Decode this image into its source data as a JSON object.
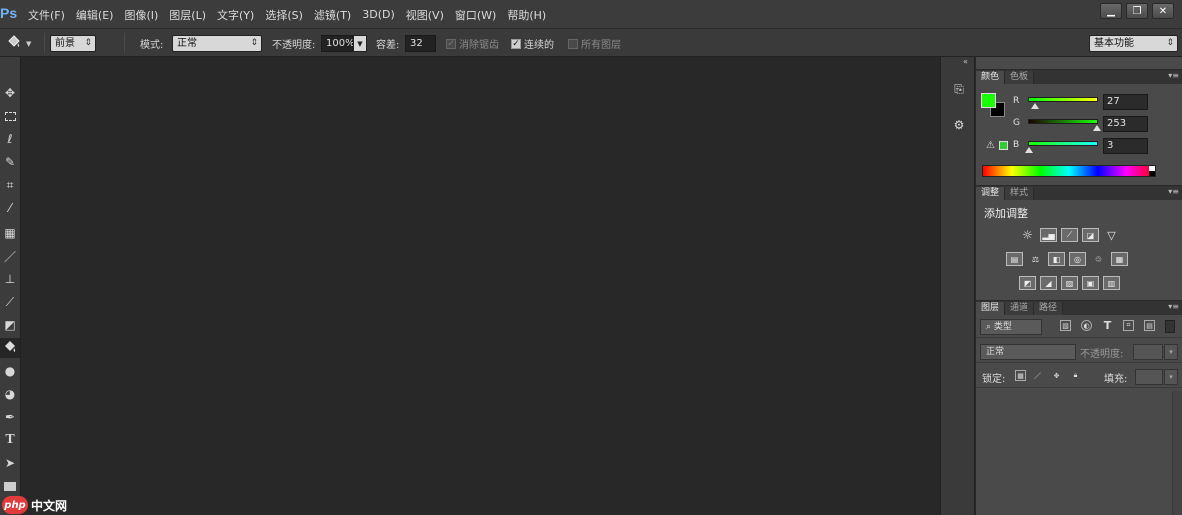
{
  "app": {
    "logo": "Ps"
  },
  "menu": [
    "文件(F)",
    "编辑(E)",
    "图像(I)",
    "图层(L)",
    "文字(Y)",
    "选择(S)",
    "滤镜(T)",
    "3D(D)",
    "视图(V)",
    "窗口(W)",
    "帮助(H)"
  ],
  "window_controls": {
    "minimize": "▁",
    "restore": "❐",
    "close": "✕"
  },
  "options": {
    "fill_source": "前景",
    "mode_label": "模式:",
    "mode_value": "正常",
    "opacity_label": "不透明度:",
    "opacity_value": "100%",
    "tolerance_label": "容差:",
    "tolerance_value": "32",
    "antialias_label": "消除锯齿",
    "contiguous_label": "连续的",
    "all_layers_label": "所有图层",
    "workspace": "基本功能"
  },
  "tools": [
    "move-icon",
    "marquee-icon",
    "lasso-icon",
    "quick-select-icon",
    "crop-icon",
    "eyedropper-icon",
    "healing-icon",
    "brush-icon",
    "stamp-icon",
    "history-brush-icon",
    "eraser-icon",
    "paint-bucket-icon",
    "blur-icon",
    "dodge-icon",
    "pen-icon",
    "type-icon",
    "path-select-icon",
    "shape-icon"
  ],
  "type_tool_glyph": "T",
  "color_panel": {
    "tabs": [
      "颜色",
      "色板"
    ],
    "foreground": "#1bfd03",
    "background": "#000000",
    "r_label": "R",
    "r_value": "27",
    "r_fraction": 0.106,
    "g_label": "G",
    "g_value": "253",
    "g_fraction": 0.992,
    "b_label": "B",
    "b_value": "3",
    "b_fraction": 0.012
  },
  "adjust_panel": {
    "tabs": [
      "调整",
      "样式"
    ],
    "title": "添加调整"
  },
  "layers_panel": {
    "tabs": [
      "图层",
      "通道",
      "路径"
    ],
    "filter_type": "类型",
    "blend_mode": "正常",
    "opacity_label": "不透明度:",
    "lock_label": "锁定:",
    "fill_label": "填充:"
  },
  "watermark": {
    "logo": "php",
    "text": "中文网"
  }
}
